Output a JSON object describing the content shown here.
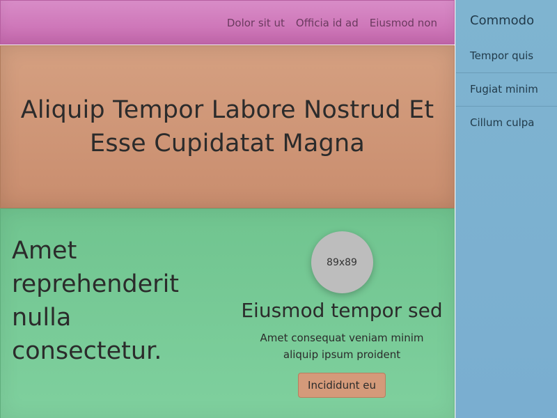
{
  "nav": {
    "links": [
      "Dolor sit ut",
      "Officia id ad",
      "Eiusmod non"
    ]
  },
  "hero": {
    "title": "Aliquip Tempor Labore Nostrud Et Esse Cupidatat Magna"
  },
  "content": {
    "heading": "Amet reprehenderit nulla consectetur.",
    "card": {
      "avatar_text": "89x89",
      "title": "Eiusmod tempor sed",
      "text": "Amet consequat veniam minim aliquip ipsum proident",
      "button_label": "Incididunt eu"
    }
  },
  "sidebar": {
    "title": "Commodo",
    "items": [
      "Tempor quis",
      "Fugiat minim",
      "Cillum culpa"
    ]
  },
  "colors": {
    "nav_bg": "#d88cc7",
    "hero_bg": "#d5a081",
    "content_bg": "#7fd09e",
    "sidebar_bg": "#7fb4d0",
    "button_bg": "#d49a7a",
    "avatar_bg": "#bdbdbd"
  }
}
